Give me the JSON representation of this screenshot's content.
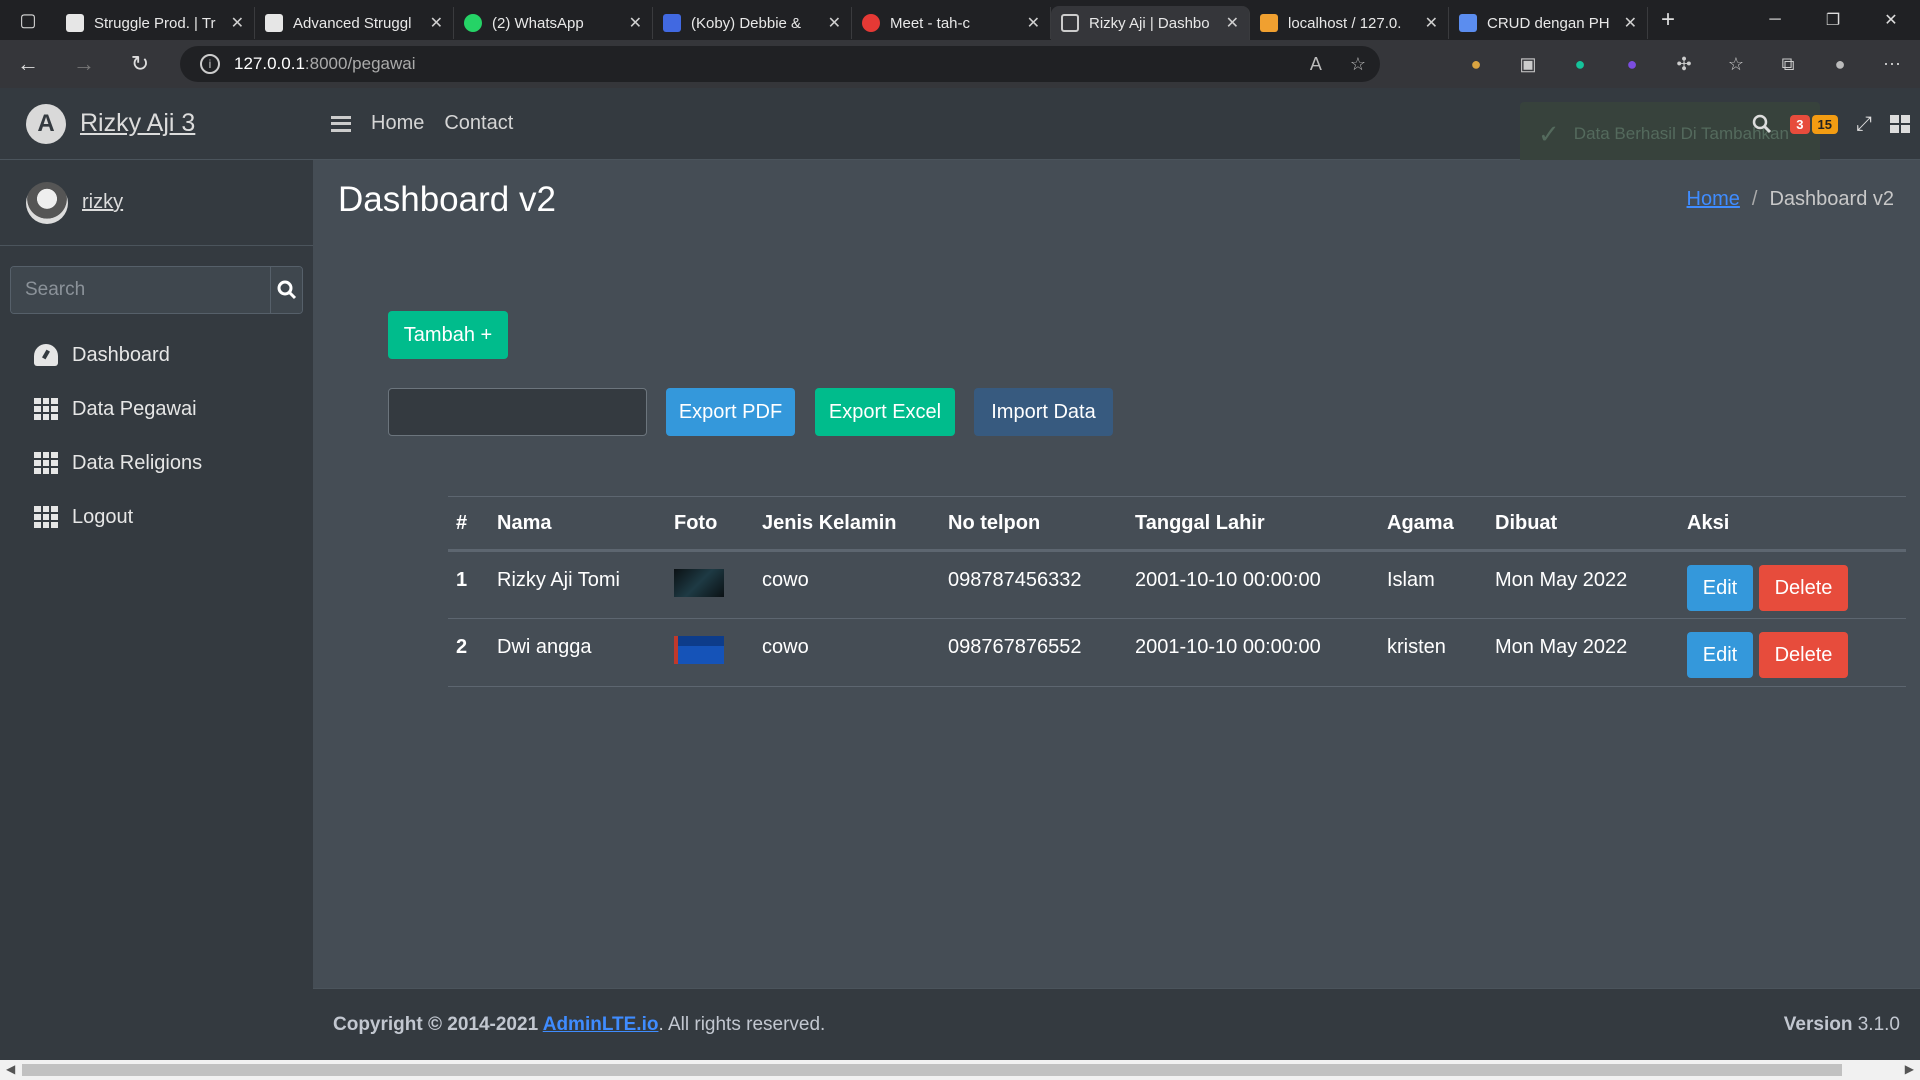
{
  "browser": {
    "tabs": [
      {
        "title": "Struggle Prod. | Tr",
        "color": "#e6e6e6"
      },
      {
        "title": "Advanced Struggl",
        "color": "#e6e6e6"
      },
      {
        "title": "(2) WhatsApp",
        "color": "#25d366"
      },
      {
        "title": "(Koby) Debbie &",
        "color": "#4169e1"
      },
      {
        "title": "Meet - tah-c",
        "color": "#e53935"
      },
      {
        "title": "Rizky Aji | Dashbo",
        "color": "#cccccc"
      },
      {
        "title": "localhost / 127.0.",
        "color": "#f0a030"
      },
      {
        "title": "CRUD dengan PH",
        "color": "#5b8def"
      }
    ],
    "url_host": "127.0.0.1",
    "url_path": ":8000/pegawai"
  },
  "sidebar": {
    "brand": "Rizky Aji 3",
    "user": "rizky",
    "search_placeholder": "Search",
    "items": [
      {
        "label": "Dashboard"
      },
      {
        "label": "Data Pegawai"
      },
      {
        "label": "Data Religions"
      },
      {
        "label": "Logout"
      }
    ]
  },
  "topnav": {
    "home": "Home",
    "contact": "Contact",
    "badge_red": "3",
    "badge_yellow": "15",
    "toast": "Data Berhasil Di Tambahkan"
  },
  "page": {
    "title": "Dashboard v2",
    "breadcrumb_home": "Home",
    "breadcrumb_current": "Dashboard v2"
  },
  "buttons": {
    "tambah": "Tambah +",
    "export_pdf": "Export PDF",
    "export_excel": "Export Excel",
    "import_data": "Import Data"
  },
  "table": {
    "headers": [
      "#",
      "Nama",
      "Foto",
      "Jenis Kelamin",
      "No telpon",
      "Tanggal Lahir",
      "Agama",
      "Dibuat",
      "Aksi"
    ],
    "rows": [
      {
        "no": "1",
        "nama": "Rizky Aji Tomi",
        "jk": "cowo",
        "telp": "098787456332",
        "lahir": "2001-10-10 00:00:00",
        "agama": "Islam",
        "dibuat": "Mon May 2022"
      },
      {
        "no": "2",
        "nama": "Dwi angga",
        "jk": "cowo",
        "telp": "098767876552",
        "lahir": "2001-10-10 00:00:00",
        "agama": "kristen",
        "dibuat": "Mon May 2022"
      }
    ],
    "edit_label": "Edit",
    "delete_label": "Delete"
  },
  "footer": {
    "copyright": "Copyright © 2014-2021 ",
    "link": "AdminLTE.io",
    "rest": ". All rights reserved.",
    "version_label": "Version",
    "version": "3.1.0"
  },
  "colors": {
    "success": "#00bc8c",
    "info": "#3498db",
    "primary": "#375a7f",
    "danger": "#e74c3c"
  }
}
